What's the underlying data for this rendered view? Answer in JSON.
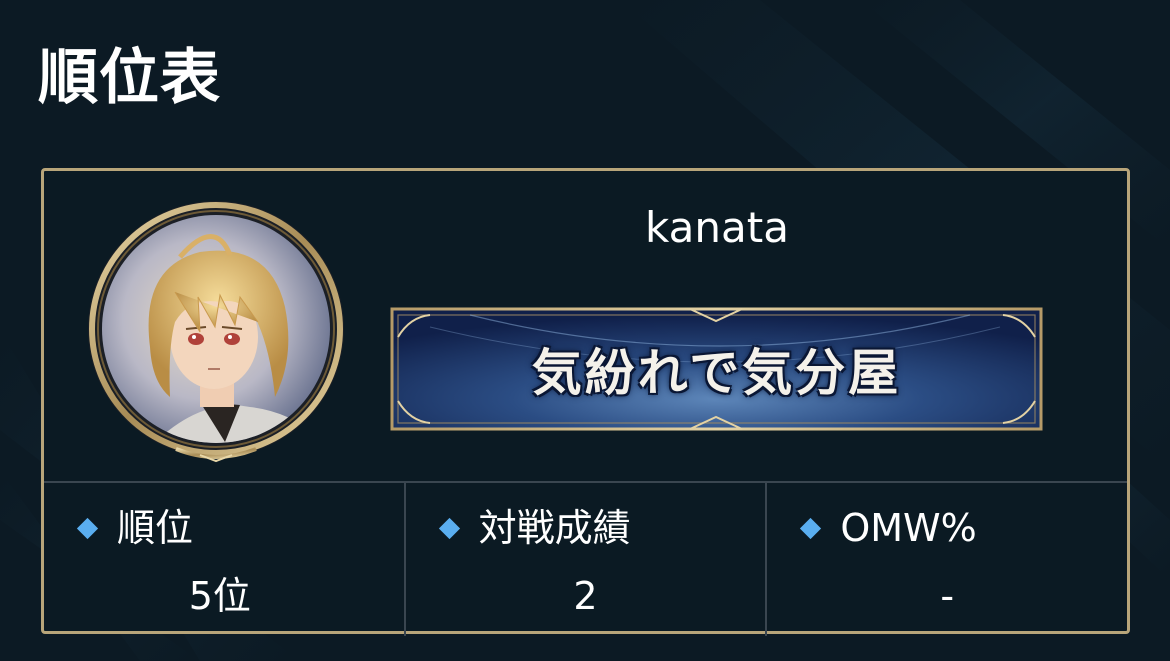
{
  "header": {
    "title": "順位表"
  },
  "player": {
    "name": "kanata",
    "title_badge": "気紛れで気分屋"
  },
  "stats": [
    {
      "label": "順位",
      "value": "5位",
      "icon": "diamond-icon"
    },
    {
      "label": "対戦成績",
      "value": "2",
      "icon": "diamond-icon"
    },
    {
      "label": "OMW%",
      "value": "-",
      "icon": "diamond-icon"
    }
  ],
  "colors": {
    "background": "#0c1a24",
    "card_border": "#b8a57a",
    "divider": "#3a4650",
    "accent_diamond": "#5aaef0",
    "banner_blue": "#1f3a6e"
  }
}
